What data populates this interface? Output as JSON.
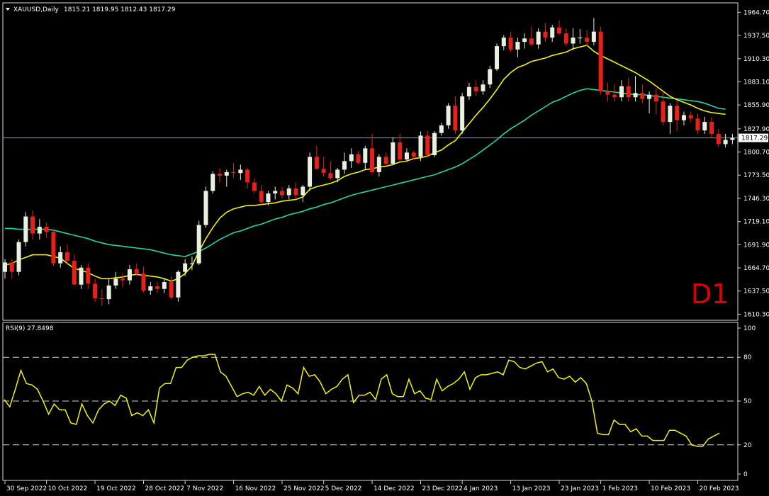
{
  "header": {
    "symbol_label": "XAUUSD,Daily",
    "ohlc_label": "1815.21 1819.95 1812.43 1817.29"
  },
  "timeframe_label": "D1",
  "colors": {
    "background": "#000000",
    "frame": "#d8d8d8",
    "bull_candle": "#e8f0e0",
    "bear_candle": "#e8201a",
    "ma_fast": "#f2f20f",
    "ma_slow": "#22d8a0",
    "rsi_line": "#f2f20f",
    "rsi_levels": "#d0d0d0",
    "price_line": "#8aa0b8",
    "price_tag_bg": "#ffffff",
    "price_tag_text": "#000000",
    "timeframe_label": "#e00000"
  },
  "chart_data": [
    {
      "type": "candlestick",
      "title": "XAUUSD,Daily",
      "price_ylim": [
        1604,
        1975
      ],
      "y_ticks": [
        "1964.70",
        "1937.50",
        "1910.30",
        "1883.10",
        "1855.90",
        "1827.90",
        "1800.70",
        "1773.50",
        "1746.30",
        "1719.10",
        "1691.90",
        "1664.70",
        "1637.50",
        "1610.30"
      ],
      "current_price": "1817.29",
      "x_ticks": [
        {
          "label": "30 Sep 2022",
          "index": 0
        },
        {
          "label": "10 Oct 2022",
          "index": 6
        },
        {
          "label": "19 Oct 2022",
          "index": 13
        },
        {
          "label": "28 Oct 2022",
          "index": 20
        },
        {
          "label": "7 Nov 2022",
          "index": 26
        },
        {
          "label": "16 Nov 2022",
          "index": 33
        },
        {
          "label": "25 Nov 2022",
          "index": 40
        },
        {
          "label": "5 Dec 2022",
          "index": 46
        },
        {
          "label": "14 Dec 2022",
          "index": 53
        },
        {
          "label": "23 Dec 2022",
          "index": 60
        },
        {
          "label": "4 Jan 2023",
          "index": 66
        },
        {
          "label": "13 Jan 2023",
          "index": 73
        },
        {
          "label": "23 Jan 2023",
          "index": 80
        },
        {
          "label": "1 Feb 2023",
          "index": 86
        },
        {
          "label": "10 Feb 2023",
          "index": 93
        },
        {
          "label": "20 Feb 2023",
          "index": 100
        }
      ],
      "candles": [
        [
          1660,
          1675,
          1652,
          1671
        ],
        [
          1671,
          1675,
          1652,
          1660
        ],
        [
          1660,
          1698,
          1656,
          1695
        ],
        [
          1695,
          1730,
          1690,
          1725
        ],
        [
          1725,
          1732,
          1698,
          1705
        ],
        [
          1705,
          1722,
          1698,
          1713
        ],
        [
          1713,
          1718,
          1700,
          1707
        ],
        [
          1707,
          1710,
          1667,
          1670
        ],
        [
          1670,
          1690,
          1665,
          1683
        ],
        [
          1683,
          1692,
          1668,
          1673
        ],
        [
          1673,
          1680,
          1645,
          1645
        ],
        [
          1645,
          1668,
          1640,
          1665
        ],
        [
          1665,
          1670,
          1640,
          1646
        ],
        [
          1646,
          1652,
          1625,
          1629
        ],
        [
          1629,
          1640,
          1620,
          1628
        ],
        [
          1628,
          1652,
          1622,
          1644
        ],
        [
          1644,
          1660,
          1640,
          1652
        ],
        [
          1652,
          1658,
          1642,
          1650
        ],
        [
          1650,
          1668,
          1645,
          1663
        ],
        [
          1663,
          1670,
          1655,
          1658
        ],
        [
          1658,
          1666,
          1636,
          1638
        ],
        [
          1638,
          1648,
          1633,
          1643
        ],
        [
          1643,
          1648,
          1635,
          1640
        ],
        [
          1640,
          1652,
          1635,
          1648
        ],
        [
          1648,
          1655,
          1628,
          1630
        ],
        [
          1630,
          1662,
          1625,
          1660
        ],
        [
          1660,
          1675,
          1655,
          1670
        ],
        [
          1670,
          1678,
          1662,
          1670
        ],
        [
          1670,
          1720,
          1668,
          1715
        ],
        [
          1715,
          1760,
          1712,
          1755
        ],
        [
          1755,
          1778,
          1752,
          1775
        ],
        [
          1775,
          1782,
          1765,
          1773
        ],
        [
          1773,
          1780,
          1760,
          1777
        ],
        [
          1777,
          1788,
          1770,
          1776
        ],
        [
          1776,
          1786,
          1768,
          1780
        ],
        [
          1780,
          1782,
          1758,
          1765
        ],
        [
          1765,
          1770,
          1752,
          1755
        ],
        [
          1755,
          1762,
          1738,
          1742
        ],
        [
          1742,
          1755,
          1738,
          1752
        ],
        [
          1752,
          1760,
          1745,
          1755
        ],
        [
          1755,
          1760,
          1746,
          1750
        ],
        [
          1750,
          1762,
          1745,
          1758
        ],
        [
          1758,
          1765,
          1745,
          1750
        ],
        [
          1750,
          1762,
          1742,
          1760
        ],
        [
          1760,
          1800,
          1755,
          1795
        ],
        [
          1795,
          1808,
          1780,
          1781
        ],
        [
          1781,
          1795,
          1772,
          1776
        ],
        [
          1776,
          1790,
          1768,
          1770
        ],
        [
          1770,
          1782,
          1765,
          1780
        ],
        [
          1780,
          1800,
          1775,
          1790
        ],
        [
          1790,
          1805,
          1782,
          1798
        ],
        [
          1798,
          1802,
          1786,
          1788
        ],
        [
          1788,
          1808,
          1780,
          1805
        ],
        [
          1805,
          1822,
          1776,
          1777
        ],
        [
          1777,
          1798,
          1772,
          1795
        ],
        [
          1795,
          1800,
          1785,
          1787
        ],
        [
          1787,
          1818,
          1785,
          1812
        ],
        [
          1812,
          1822,
          1790,
          1792
        ],
        [
          1792,
          1805,
          1790,
          1800
        ],
        [
          1800,
          1802,
          1792,
          1795
        ],
        [
          1795,
          1825,
          1790,
          1820
        ],
        [
          1820,
          1826,
          1795,
          1797
        ],
        [
          1797,
          1825,
          1795,
          1823
        ],
        [
          1823,
          1835,
          1820,
          1832
        ],
        [
          1832,
          1858,
          1828,
          1855
        ],
        [
          1855,
          1866,
          1822,
          1826
        ],
        [
          1826,
          1870,
          1822,
          1866
        ],
        [
          1866,
          1882,
          1862,
          1877
        ],
        [
          1877,
          1885,
          1866,
          1872
        ],
        [
          1872,
          1885,
          1868,
          1880
        ],
        [
          1880,
          1902,
          1876,
          1898
        ],
        [
          1898,
          1928,
          1896,
          1925
        ],
        [
          1925,
          1938,
          1920,
          1935
        ],
        [
          1935,
          1942,
          1918,
          1921
        ],
        [
          1921,
          1935,
          1912,
          1930
        ],
        [
          1930,
          1940,
          1922,
          1934
        ],
        [
          1934,
          1948,
          1925,
          1927
        ],
        [
          1927,
          1946,
          1922,
          1942
        ],
        [
          1942,
          1952,
          1930,
          1935
        ],
        [
          1935,
          1950,
          1930,
          1947
        ],
        [
          1947,
          1955,
          1938,
          1940
        ],
        [
          1940,
          1946,
          1925,
          1928
        ],
        [
          1928,
          1946,
          1920,
          1935
        ],
        [
          1935,
          1945,
          1928,
          1935
        ],
        [
          1935,
          1944,
          1925,
          1930
        ],
        [
          1930,
          1958,
          1926,
          1942
        ],
        [
          1942,
          1948,
          1868,
          1872
        ],
        [
          1872,
          1882,
          1860,
          1868
        ],
        [
          1868,
          1880,
          1860,
          1865
        ],
        [
          1865,
          1885,
          1860,
          1878
        ],
        [
          1878,
          1888,
          1860,
          1865
        ],
        [
          1865,
          1890,
          1860,
          1870
        ],
        [
          1870,
          1880,
          1858,
          1863
        ],
        [
          1863,
          1872,
          1846,
          1868
        ],
        [
          1868,
          1875,
          1845,
          1860
        ],
        [
          1860,
          1872,
          1832,
          1836
        ],
        [
          1836,
          1858,
          1822,
          1855
        ],
        [
          1855,
          1862,
          1825,
          1838
        ],
        [
          1838,
          1848,
          1832,
          1844
        ],
        [
          1844,
          1848,
          1836,
          1840
        ],
        [
          1840,
          1846,
          1822,
          1826
        ],
        [
          1826,
          1842,
          1822,
          1836
        ],
        [
          1836,
          1842,
          1818,
          1822
        ],
        [
          1822,
          1828,
          1806,
          1810
        ],
        [
          1810,
          1822,
          1806,
          1815
        ],
        [
          1815,
          1822,
          1810,
          1817
        ]
      ],
      "ma_fast": [
        1668,
        1670,
        1674,
        1677,
        1680,
        1680,
        1680,
        1678,
        1676,
        1670,
        1664,
        1662,
        1659,
        1655,
        1652,
        1652,
        1653,
        1654,
        1656,
        1657,
        1656,
        1655,
        1654,
        1652,
        1649,
        1652,
        1658,
        1667,
        1684,
        1699,
        1712,
        1723,
        1730,
        1734,
        1736,
        1738,
        1738,
        1739,
        1740,
        1741,
        1743,
        1744,
        1745,
        1748,
        1757,
        1760,
        1762,
        1764,
        1767,
        1772,
        1775,
        1777,
        1780,
        1781,
        1783,
        1784,
        1786,
        1789,
        1790,
        1793,
        1794,
        1796,
        1800,
        1803,
        1809,
        1814,
        1824,
        1834,
        1844,
        1853,
        1863,
        1874,
        1886,
        1894,
        1900,
        1903,
        1907,
        1909,
        1911,
        1914,
        1916,
        1918,
        1922,
        1924,
        1926,
        1919,
        1914,
        1910,
        1906,
        1902,
        1898,
        1894,
        1889,
        1884,
        1878,
        1872,
        1866,
        1862,
        1859,
        1856,
        1852,
        1849,
        1847,
        1846,
        1845
      ],
      "ma_slow": [
        1711,
        1711,
        1710,
        1710,
        1710,
        1710,
        1710,
        1709,
        1707,
        1705,
        1703,
        1701,
        1699,
        1696,
        1694,
        1692,
        1691,
        1690,
        1689,
        1688,
        1687,
        1686,
        1684,
        1682,
        1680,
        1679,
        1678,
        1681,
        1684,
        1688,
        1693,
        1698,
        1702,
        1706,
        1708,
        1711,
        1714,
        1716,
        1719,
        1722,
        1724,
        1727,
        1729,
        1731,
        1734,
        1736,
        1739,
        1741,
        1744,
        1747,
        1750,
        1752,
        1754,
        1756,
        1758,
        1760,
        1762,
        1764,
        1766,
        1768,
        1770,
        1772,
        1774,
        1777,
        1780,
        1783,
        1787,
        1792,
        1797,
        1803,
        1809,
        1815,
        1822,
        1828,
        1833,
        1838,
        1844,
        1849,
        1854,
        1859,
        1862,
        1866,
        1870,
        1873,
        1875,
        1874,
        1873,
        1872,
        1871,
        1870,
        1869,
        1868,
        1868,
        1867,
        1866,
        1865,
        1864,
        1863,
        1862,
        1861,
        1860,
        1858,
        1855,
        1852,
        1851
      ]
    },
    {
      "type": "line",
      "title": "RSI(9) 27.8498",
      "ylim": [
        0,
        100
      ],
      "y_ticks": [
        "100",
        "80",
        "50",
        "20",
        "0"
      ],
      "levels": [
        80,
        50,
        20
      ],
      "values": [
        51,
        46,
        58,
        71,
        62,
        61,
        58,
        50,
        41,
        48,
        44,
        44,
        35,
        34,
        48,
        40,
        35,
        44,
        48,
        50,
        47,
        54,
        52,
        40,
        42,
        40,
        44,
        35,
        59,
        62,
        62,
        73,
        73,
        78,
        80,
        81,
        81,
        82,
        82,
        70,
        67,
        60,
        53,
        55,
        56,
        54,
        60,
        54,
        58,
        55,
        50,
        61,
        59,
        55,
        73,
        67,
        68,
        63,
        55,
        58,
        60,
        65,
        68,
        49,
        54,
        54,
        56,
        51,
        65,
        68,
        55,
        53,
        53,
        65,
        55,
        57,
        52,
        51,
        65,
        57,
        60,
        62,
        65,
        70,
        58,
        66,
        68,
        68,
        69,
        70,
        68,
        78,
        77,
        73,
        72,
        74,
        76,
        77,
        70,
        72,
        66,
        65,
        67,
        63,
        66,
        62,
        50,
        28,
        27,
        27,
        37,
        34,
        34,
        29,
        31,
        26,
        26,
        23,
        23,
        23,
        30,
        30,
        28,
        26,
        20,
        19,
        19,
        24,
        26,
        28
      ]
    }
  ]
}
